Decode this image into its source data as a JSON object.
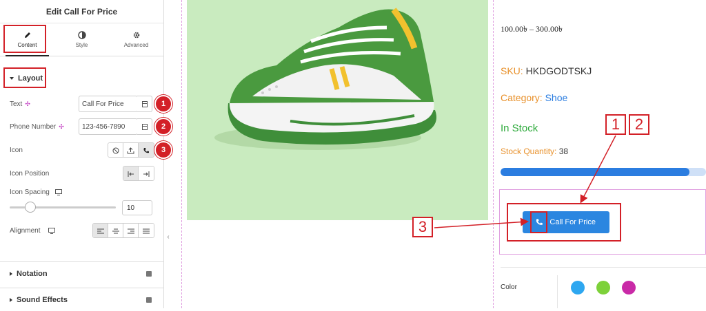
{
  "panel": {
    "title": "Edit Call For Price",
    "tabs": [
      {
        "label": "Content",
        "icon": "pencil-icon",
        "active": true
      },
      {
        "label": "Style",
        "icon": "contrast-icon",
        "active": false
      },
      {
        "label": "Advanced",
        "icon": "gear-icon",
        "active": false
      }
    ],
    "layout_section": "Layout",
    "controls": {
      "text_label": "Text",
      "text_value": "Call For Price",
      "phone_label": "Phone Number",
      "phone_value": "123-456-7890",
      "icon_label": "Icon",
      "icon_position_label": "Icon Position",
      "icon_spacing_label": "Icon Spacing",
      "icon_spacing_value": "10",
      "alignment_label": "Alignment"
    },
    "collapsed_sections": [
      "Notation",
      "Sound Effects"
    ],
    "badges": [
      "1",
      "2",
      "3"
    ]
  },
  "product": {
    "price": "100.00৳ – 300.00৳",
    "sku_label": "SKU:",
    "sku_value": "HKDGODTSKJ",
    "category_label": "Category:",
    "category_value": "Shoe",
    "stock_status": "In Stock",
    "stock_qty_label": "Stock Quantity:",
    "stock_qty_value": "38",
    "stock_fill": 0.92,
    "button_label": "Call For Price",
    "color_label": "Color",
    "swatches": [
      "#2ea7f0",
      "#7dd13a",
      "#c92aa7"
    ]
  },
  "annotations": {
    "box_1": "1",
    "box_2": "2",
    "box_3": "3"
  },
  "colors": {
    "accent_red": "#d32027",
    "button_blue": "#2b86e0",
    "product_bg": "#c9ebbf"
  }
}
